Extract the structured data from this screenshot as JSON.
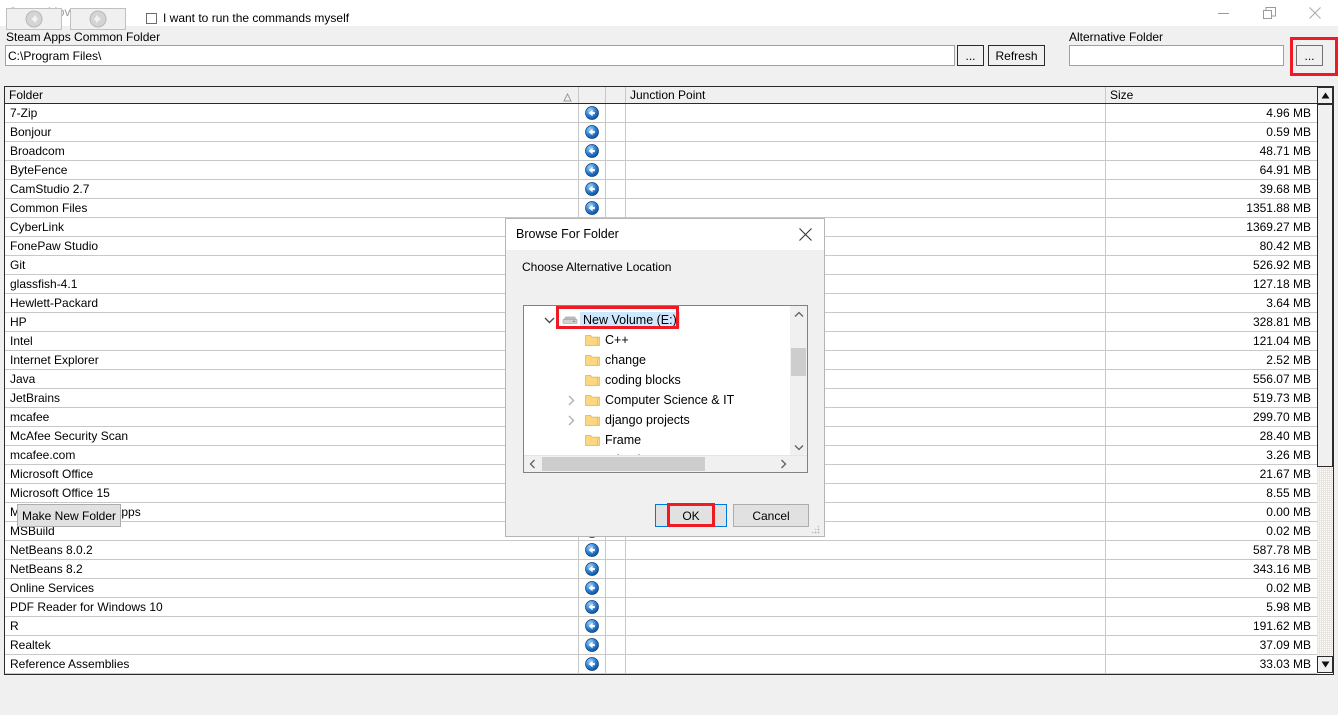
{
  "window": {
    "title": "Steam Mover",
    "controls": {
      "minimize": "minimize-icon",
      "restore": "restore-icon",
      "close": "close-icon"
    }
  },
  "toolbar": {
    "common_folder_label": "Steam Apps Common Folder",
    "common_folder_value": "C:\\Program Files\\",
    "common_browse_label": "...",
    "refresh_label": "Refresh",
    "alt_folder_label": "Alternative Folder",
    "alt_folder_value": "",
    "alt_folder_placeholder": "",
    "alt_browse_label": "..."
  },
  "list": {
    "columns": [
      "Folder",
      "",
      "",
      "Junction Point",
      "Size"
    ],
    "sort_indicator": "ascending",
    "rows": [
      {
        "folder": "7-Zip",
        "junction": "",
        "size": "4.96 MB",
        "has_icon": true
      },
      {
        "folder": "Bonjour",
        "junction": "",
        "size": "0.59 MB",
        "has_icon": true
      },
      {
        "folder": "Broadcom",
        "junction": "",
        "size": "48.71 MB",
        "has_icon": true
      },
      {
        "folder": "ByteFence",
        "junction": "",
        "size": "64.91 MB",
        "has_icon": true
      },
      {
        "folder": "CamStudio 2.7",
        "junction": "",
        "size": "39.68 MB",
        "has_icon": true
      },
      {
        "folder": "Common Files",
        "junction": "",
        "size": "1351.88 MB",
        "has_icon": true
      },
      {
        "folder": "CyberLink",
        "junction": "",
        "size": "1369.27 MB",
        "has_icon": true
      },
      {
        "folder": "FonePaw Studio",
        "junction": "",
        "size": "80.42 MB",
        "has_icon": true
      },
      {
        "folder": "Git",
        "junction": "",
        "size": "526.92 MB",
        "has_icon": true
      },
      {
        "folder": "glassfish-4.1",
        "junction": "",
        "size": "127.18 MB",
        "has_icon": true
      },
      {
        "folder": "Hewlett-Packard",
        "junction": "",
        "size": "3.64 MB",
        "has_icon": true
      },
      {
        "folder": "HP",
        "junction": "",
        "size": "328.81 MB",
        "has_icon": true
      },
      {
        "folder": "Intel",
        "junction": "",
        "size": "121.04 MB",
        "has_icon": true
      },
      {
        "folder": "Internet Explorer",
        "junction": "",
        "size": "2.52 MB",
        "has_icon": true
      },
      {
        "folder": "Java",
        "junction": "",
        "size": "556.07 MB",
        "has_icon": true
      },
      {
        "folder": "JetBrains",
        "junction": "",
        "size": "519.73 MB",
        "has_icon": true
      },
      {
        "folder": "mcafee",
        "junction": "",
        "size": "299.70 MB",
        "has_icon": true
      },
      {
        "folder": "McAfee Security Scan",
        "junction": "",
        "size": "28.40 MB",
        "has_icon": true
      },
      {
        "folder": "mcafee.com",
        "junction": "",
        "size": "3.26 MB",
        "has_icon": true
      },
      {
        "folder": "Microsoft Office",
        "junction": "",
        "size": "21.67 MB",
        "has_icon": true
      },
      {
        "folder": "Microsoft Office 15",
        "junction": "",
        "size": "8.55 MB",
        "has_icon": true
      },
      {
        "folder": "ModifiableWindowsApps",
        "junction": "",
        "size": "0.00 MB",
        "has_icon": true
      },
      {
        "folder": "MSBuild",
        "junction": "",
        "size": "0.02 MB",
        "has_icon": true
      },
      {
        "folder": "NetBeans 8.0.2",
        "junction": "",
        "size": "587.78 MB",
        "has_icon": true
      },
      {
        "folder": "NetBeans 8.2",
        "junction": "",
        "size": "343.16 MB",
        "has_icon": true
      },
      {
        "folder": "Online Services",
        "junction": "",
        "size": "0.02 MB",
        "has_icon": true
      },
      {
        "folder": "PDF Reader for Windows 10",
        "junction": "",
        "size": "5.98 MB",
        "has_icon": true
      },
      {
        "folder": "R",
        "junction": "",
        "size": "191.62 MB",
        "has_icon": true
      },
      {
        "folder": "Realtek",
        "junction": "",
        "size": "37.09 MB",
        "has_icon": true
      },
      {
        "folder": "Reference Assemblies",
        "junction": "",
        "size": "33.03 MB",
        "has_icon": true
      }
    ]
  },
  "bottom": {
    "back_icon": "arrow-left-circle-icon",
    "forward_icon": "arrow-right-circle-icon",
    "checkbox_label": "I want to run the commands myself",
    "checkbox_checked": false
  },
  "dialog": {
    "title": "Browse For Folder",
    "prompt": "Choose Alternative Location",
    "tree": [
      {
        "label": "New Volume (E:)",
        "icon": "drive-icon",
        "expander": "chevron-down",
        "indent": 0,
        "selected": true
      },
      {
        "label": "C++",
        "icon": "folder-icon",
        "expander": "",
        "indent": 1,
        "selected": false
      },
      {
        "label": "change",
        "icon": "folder-icon",
        "expander": "",
        "indent": 1,
        "selected": false
      },
      {
        "label": "coding blocks",
        "icon": "folder-icon",
        "expander": "",
        "indent": 1,
        "selected": false
      },
      {
        "label": "Computer Science & IT",
        "icon": "folder-icon",
        "expander": "chevron-right",
        "indent": 1,
        "selected": false
      },
      {
        "label": "django projects",
        "icon": "folder-icon",
        "expander": "chevron-right",
        "indent": 1,
        "selected": false
      },
      {
        "label": "Frame",
        "icon": "folder-icon",
        "expander": "",
        "indent": 1,
        "selected": false
      },
      {
        "label": "Friends",
        "icon": "folder-icon",
        "expander": "chevron-right",
        "indent": 1,
        "selected": false
      }
    ],
    "make_new_folder_label": "Make New Folder",
    "ok_label": "OK",
    "cancel_label": "Cancel"
  },
  "colors": {
    "annotation": "#ef1b24",
    "selection": "#cde8ff",
    "focus": "#0078d7",
    "folder_icon": "#fbd46d"
  }
}
